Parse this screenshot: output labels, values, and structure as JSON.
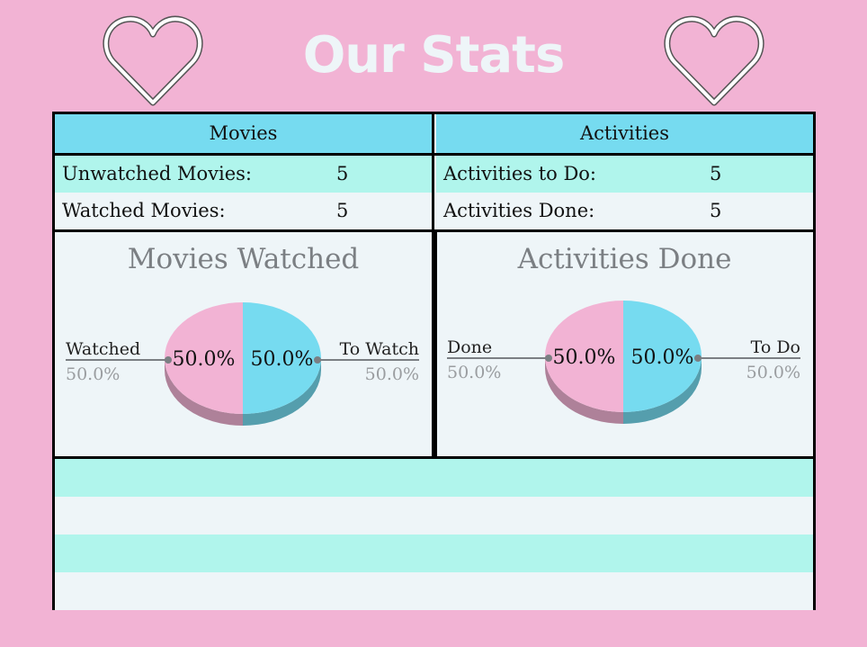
{
  "page": {
    "title": "Our Stats"
  },
  "colors": {
    "background": "#f2b3d4",
    "header": "#76dbf0",
    "mint": "#b0f5ec",
    "pale": "#eef5f8",
    "pink": "#f2b3d4",
    "blue": "#76dbf0"
  },
  "movies": {
    "header": "Movies",
    "unwatched_label": "Unwatched Movies:",
    "unwatched_value": "5",
    "watched_label": "Watched Movies:",
    "watched_value": "5"
  },
  "activities": {
    "header": "Activities",
    "todo_label": "Activities to Do:",
    "todo_value": "5",
    "done_label": "Activities Done:",
    "done_value": "5"
  },
  "chart_data": [
    {
      "type": "pie",
      "title": "Movies Watched",
      "slices": [
        {
          "name": "Watched",
          "value": 50.0,
          "label": "50.0%",
          "color": "#f2b3d4"
        },
        {
          "name": "To Watch",
          "value": 50.0,
          "label": "50.0%",
          "color": "#76dbf0"
        }
      ]
    },
    {
      "type": "pie",
      "title": "Activities Done",
      "slices": [
        {
          "name": "Done",
          "value": 50.0,
          "label": "50.0%",
          "color": "#f2b3d4"
        },
        {
          "name": "To Do",
          "value": 50.0,
          "label": "50.0%",
          "color": "#76dbf0"
        }
      ]
    }
  ]
}
